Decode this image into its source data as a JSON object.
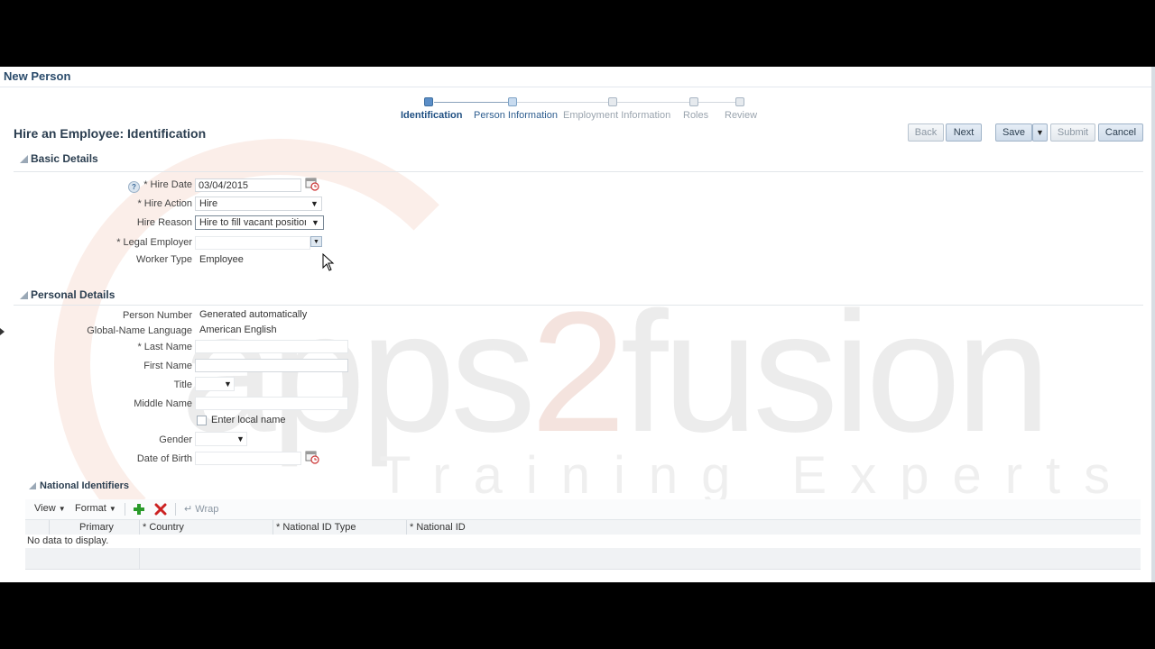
{
  "app": {
    "title": "New Person"
  },
  "train": {
    "stops": [
      {
        "label": "Identification",
        "state": "current"
      },
      {
        "label": "Person Information",
        "state": "visited"
      },
      {
        "label": "Employment Information",
        "state": "unvisited"
      },
      {
        "label": "Roles",
        "state": "unvisited"
      },
      {
        "label": "Review",
        "state": "unvisited"
      }
    ]
  },
  "page": {
    "title": "Hire an Employee: Identification"
  },
  "buttons": {
    "back": "Back",
    "next": "Next",
    "save": "Save",
    "submit": "Submit",
    "cancel": "Cancel"
  },
  "basic_details": {
    "heading": "Basic Details",
    "hire_date": {
      "label": "* Hire Date",
      "value": "03/04/2015"
    },
    "hire_action": {
      "label": "* Hire Action",
      "value": "Hire"
    },
    "hire_reason": {
      "label": "Hire Reason",
      "value": "Hire to fill vacant position"
    },
    "legal_employer": {
      "label": "* Legal Employer",
      "value": ""
    },
    "worker_type": {
      "label": "Worker Type",
      "value": "Employee"
    }
  },
  "personal_details": {
    "heading": "Personal Details",
    "person_number": {
      "label": "Person Number",
      "value": "Generated automatically"
    },
    "global_name_language": {
      "label": "Global-Name Language",
      "value": "American English"
    },
    "last_name": {
      "label": "* Last Name",
      "value": ""
    },
    "first_name": {
      "label": "First Name",
      "value": ""
    },
    "title": {
      "label": "Title",
      "value": ""
    },
    "middle_name": {
      "label": "Middle Name",
      "value": ""
    },
    "enter_local_name": {
      "label": "Enter local name",
      "checked": false
    },
    "gender": {
      "label": "Gender",
      "value": ""
    },
    "date_of_birth": {
      "label": "Date of Birth",
      "value": ""
    }
  },
  "national_identifiers": {
    "heading": "National Identifiers",
    "toolbar": {
      "view": "View",
      "format": "Format",
      "wrap": "Wrap"
    },
    "columns": [
      "Primary",
      "* Country",
      "* National ID Type",
      "* National ID"
    ],
    "empty_text": "No data to display."
  },
  "watermark": {
    "brand_part1": "apps",
    "brand_part2": "2",
    "brand_part3": "fusion",
    "tagline": "Training Experts"
  },
  "icons": {
    "help": "help-icon",
    "calendar": "calendar-icon",
    "add": "add-icon",
    "delete": "delete-icon",
    "wrap": "wrap-icon"
  },
  "colors": {
    "accent": "#2a4b6b",
    "current_stop": "#5b8ec7",
    "add_icon": "#2a9a2a",
    "delete_icon": "#cc2222"
  }
}
